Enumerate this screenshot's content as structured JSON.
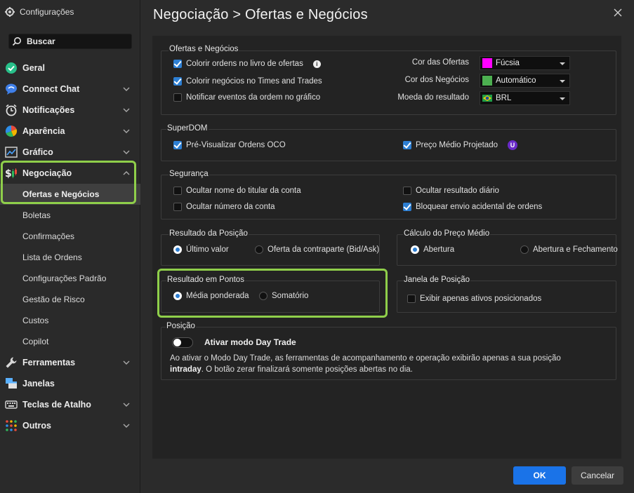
{
  "app": {
    "title": "Configurações"
  },
  "search": {
    "placeholder": "Buscar"
  },
  "sidebar": {
    "items": [
      {
        "label": "Geral",
        "icon": "check-circle-icon"
      },
      {
        "label": "Connect Chat",
        "icon": "chat-icon"
      },
      {
        "label": "Notificações",
        "icon": "alarm-icon"
      },
      {
        "label": "Aparência",
        "icon": "palette-icon"
      },
      {
        "label": "Gráfico",
        "icon": "chart-icon"
      },
      {
        "label": "Negociação",
        "icon": "trading-icon"
      },
      {
        "label": "Ferramentas",
        "icon": "wrench-icon"
      },
      {
        "label": "Janelas",
        "icon": "windows-icon"
      },
      {
        "label": "Teclas de Atalho",
        "icon": "keyboard-icon"
      },
      {
        "label": "Outros",
        "icon": "dots-grid-icon"
      }
    ],
    "subitems": [
      "Ofertas e Negócios",
      "Boletas",
      "Confirmações",
      "Lista de Ordens",
      "Configurações Padrão",
      "Gestão de Risco",
      "Custos",
      "Copilot"
    ]
  },
  "header": {
    "title": "Negociação > Ofertas e Negócios"
  },
  "ofertas": {
    "title": "Ofertas e Negócios",
    "opt1": "Colorir ordens no livro de ofertas",
    "opt2": "Colorir negócios no Times and Trades",
    "opt3": "Notificar eventos da ordem no gráfico",
    "cor_ofertas_label": "Cor das Ofertas",
    "cor_ofertas_value": "Fúcsia",
    "cor_negocios_label": "Cor dos Negócios",
    "cor_negocios_value": "Automático",
    "moeda_label": "Moeda do resultado",
    "moeda_value": "BRL",
    "colors": {
      "fucsia": "#ff00ff",
      "automatico": "#4caf50"
    }
  },
  "superdom": {
    "title": "SuperDOM",
    "opt1": "Pré-Visualizar Ordens OCO",
    "opt2": "Preço Médio Projetado",
    "badge": "U"
  },
  "seguranca": {
    "title": "Segurança",
    "opt1": "Ocultar nome do titular da conta",
    "opt2": "Ocultar número da conta",
    "opt3": "Ocultar resultado diário",
    "opt4": "Bloquear envio acidental de ordens"
  },
  "resultado_posicao": {
    "title": "Resultado da Posição",
    "opt1": "Último valor",
    "opt2": "Oferta da contraparte (Bid/Ask)"
  },
  "calculo_preco": {
    "title": "Cálculo do Preço Médio",
    "opt1": "Abertura",
    "opt2": "Abertura e Fechamento"
  },
  "resultado_pontos": {
    "title": "Resultado em Pontos",
    "opt1": "Média ponderada",
    "opt2": "Somatório"
  },
  "janela_posicao": {
    "title": "Janela de Posição",
    "opt1": "Exibir apenas ativos posicionados"
  },
  "posicao": {
    "title": "Posição",
    "toggle_label": "Ativar modo Day Trade",
    "desc_part1": "Ao ativar o Modo Day Trade, as ferramentas de acompanhamento e operação exibirão apenas a sua posição",
    "desc_bold": "intraday",
    "desc_part2": ". O botão zerar finalizará somente posições abertas no dia."
  },
  "footer": {
    "ok": "OK",
    "cancel": "Cancelar"
  }
}
